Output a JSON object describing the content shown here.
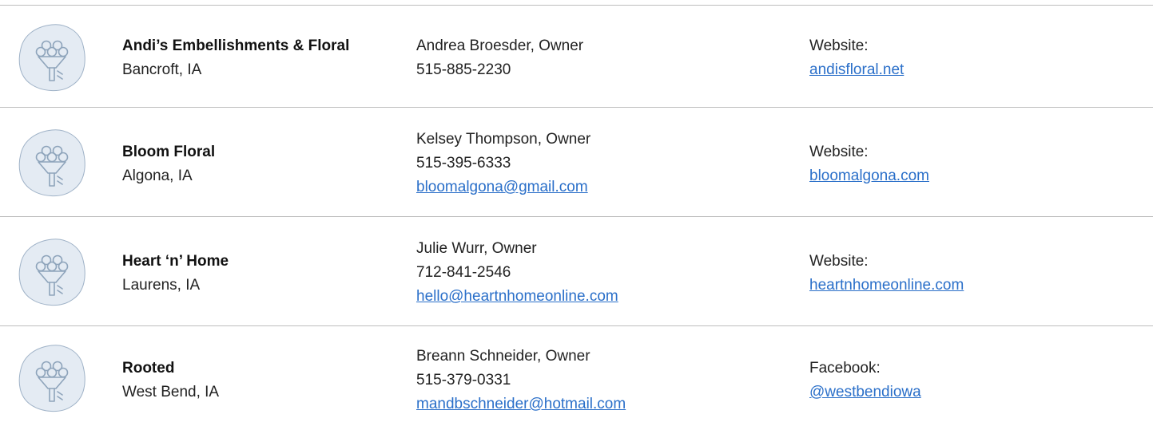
{
  "listings": [
    {
      "icon": "bouquet-icon",
      "name": "Andi’s Embellishments & Floral",
      "location": "Bancroft, IA",
      "contact_person": "Andrea Broesder, Owner",
      "phone": "515-885-2230",
      "email": "",
      "link_label": "Website:",
      "link_text": "andisfloral.net"
    },
    {
      "icon": "bouquet-icon",
      "name": "Bloom Floral",
      "location": "Algona, IA",
      "contact_person": "Kelsey Thompson, Owner",
      "phone": "515-395-6333",
      "email": "bloomalgona@gmail.com",
      "link_label": "Website:",
      "link_text": "bloomalgona.com"
    },
    {
      "icon": "bouquet-icon",
      "name": "Heart ‘n’ Home",
      "location": "Laurens, IA",
      "contact_person": "Julie Wurr, Owner",
      "phone": "712-841-2546",
      "email": "hello@heartnhomeonline.com",
      "link_label": "Website:",
      "link_text": "heartnhomeonline.com"
    },
    {
      "icon": "bouquet-icon",
      "name": "Rooted",
      "location": "West Bend, IA",
      "contact_person": "Breann Schneider, Owner",
      "phone": "515-379-0331",
      "email": "mandbschneider@hotmail.com",
      "link_label": "Facebook:",
      "link_text": "@westbendiowa"
    }
  ],
  "colors": {
    "link": "#2a6fc9",
    "divider": "#bdbdbd",
    "icon_blob": "#e4ebf3"
  }
}
